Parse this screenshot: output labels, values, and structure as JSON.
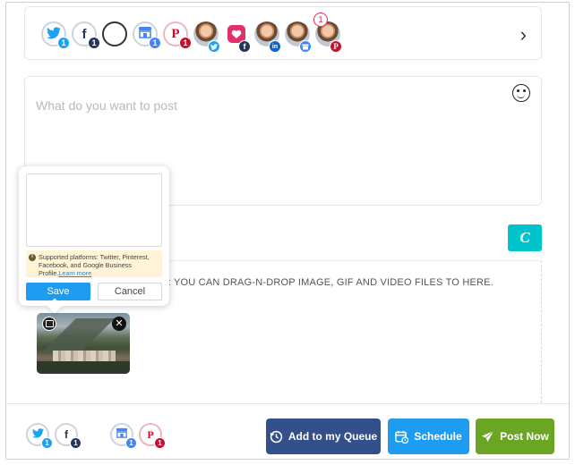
{
  "colors": {
    "twitter": "#1da1f2",
    "facebook": "#3b5998",
    "google_business": "#4285f4",
    "pinterest": "#e60023",
    "instagram": "#e1306c",
    "linkedin": "#0a66c2",
    "badge_dark": "#26355a",
    "badge_red": "#c8102e",
    "canva": "#00c4cc",
    "queue_button": "#33508a",
    "schedule_button": "#1e9cf0",
    "post_now_button": "#6aa624"
  },
  "accounts": [
    {
      "name": "twitter-account",
      "icon": "twitter-icon",
      "glyph": "✦",
      "badge": "1",
      "badge_color": "#1da1f2"
    },
    {
      "name": "facebook-account",
      "icon": "facebook-icon",
      "glyph": "f",
      "badge": "1",
      "badge_color": "#26355a"
    },
    {
      "name": "empty-account",
      "icon": "empty-circle-icon",
      "glyph": "",
      "badge": "",
      "badge_color": ""
    },
    {
      "name": "google-business-account",
      "icon": "google-business-icon",
      "glyph": "▦",
      "badge": "1",
      "badge_color": "#4285f4"
    },
    {
      "name": "pinterest-account",
      "icon": "pinterest-icon",
      "glyph": "P",
      "badge": "1",
      "badge_color": "#c8102e"
    },
    {
      "name": "profile-twitter-account",
      "icon": "twitter-icon",
      "badge_color": "#1da1f2"
    },
    {
      "name": "instagram-facebook-account",
      "icon": "facebook-icon",
      "badge_color": "#26355a"
    },
    {
      "name": "profile-linkedin-account",
      "icon": "linkedin-icon",
      "badge_color": "#0a66c2"
    },
    {
      "name": "profile-google-business-account",
      "icon": "google-business-icon",
      "badge_color": "#4285f4"
    },
    {
      "name": "profile-pinterest-account",
      "icon": "pinterest-icon",
      "badge_color": "#c8102e",
      "count": "1"
    }
  ],
  "composer": {
    "placeholder": "What do you want to post"
  },
  "media": {
    "drop_text": "AR: YOU CAN DRAG-N-DROP IMAGE, GIF AND VIDEO FILES TO HERE."
  },
  "popup": {
    "notice": "Supported platforms: Twitter, Pinterest, Facebook, and Google Business Profile.",
    "learn_more": "Learn more",
    "save_label": "Save",
    "cancel_label": "Cancel"
  },
  "footer_accounts": [
    {
      "name": "footer-twitter-account",
      "icon": "twitter-icon",
      "badge": "1",
      "badge_color": "#1da1f2"
    },
    {
      "name": "footer-facebook-account",
      "icon": "facebook-icon",
      "badge": "1",
      "badge_color": "#26355a"
    },
    {
      "name": "footer-google-business-account",
      "icon": "google-business-icon",
      "badge": "1",
      "badge_color": "#4285f4"
    },
    {
      "name": "footer-pinterest-account",
      "icon": "pinterest-icon",
      "badge": "1",
      "badge_color": "#c8102e"
    }
  ],
  "actions": {
    "queue_label": "Add to my Queue",
    "schedule_label": "Schedule",
    "post_now_label": "Post Now"
  }
}
